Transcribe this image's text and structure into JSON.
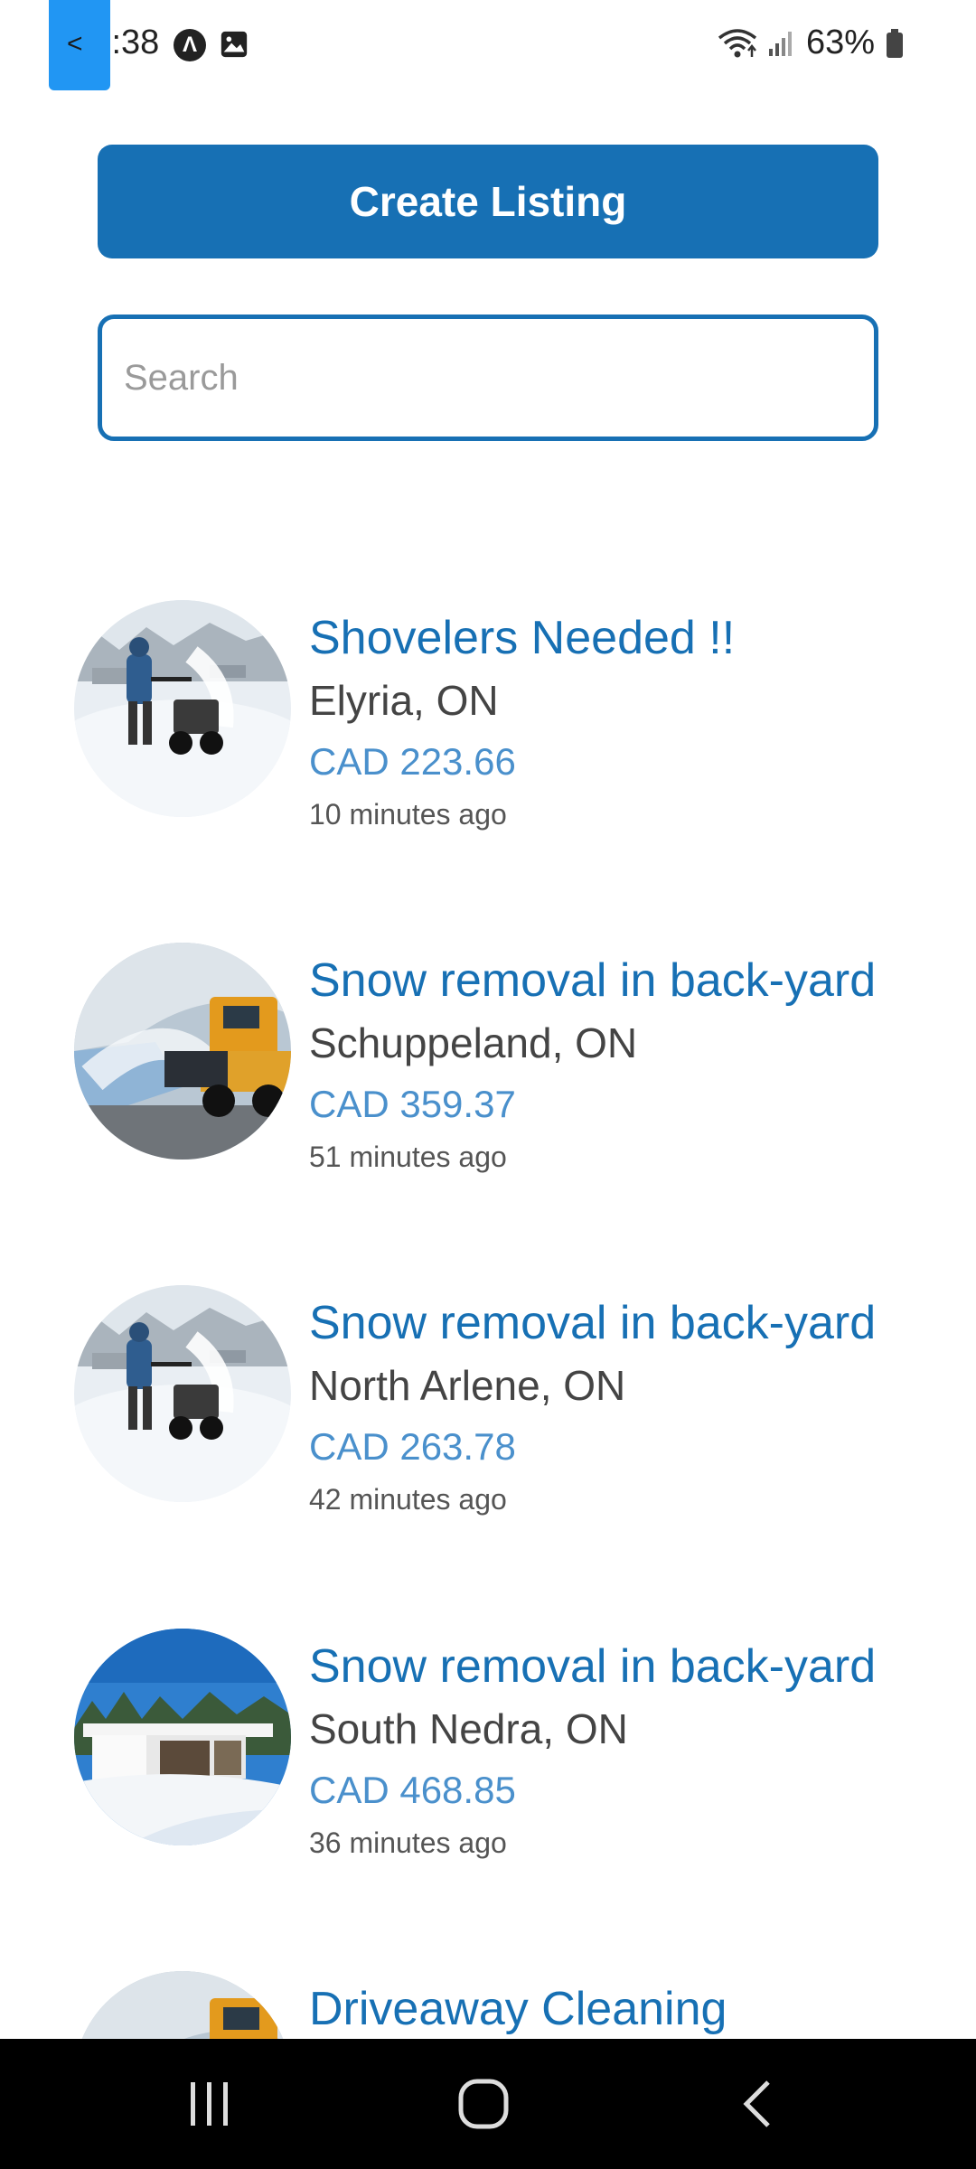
{
  "status_bar": {
    "time": "11:38",
    "battery": "63%",
    "icons": [
      "a-badge-icon",
      "image-icon",
      "wifi-icon",
      "signal-icon",
      "battery-icon"
    ]
  },
  "actions": {
    "create_label": "Create Listing"
  },
  "search": {
    "placeholder": "Search",
    "value": ""
  },
  "listings": [
    {
      "title": "Shovelers Needed !!",
      "location": "Elyria, ON",
      "price": "CAD 223.66",
      "time": "10 minutes ago",
      "image": "snowblower"
    },
    {
      "title": "Snow removal in back-yard",
      "location": "Schuppeland, ON",
      "price": "CAD 359.37",
      "time": "51 minutes ago",
      "image": "snowplow"
    },
    {
      "title": "Snow removal in back-yard",
      "location": "North Arlene, ON",
      "price": "CAD 263.78",
      "time": "42 minutes ago",
      "image": "snowblower"
    },
    {
      "title": "Snow removal in back-yard",
      "location": "South Nedra, ON",
      "price": "CAD 468.85",
      "time": "36 minutes ago",
      "image": "house"
    },
    {
      "title": "Driveaway Cleaning",
      "location": "",
      "price": "",
      "time": "",
      "image": "snowplow"
    }
  ],
  "colors": {
    "primary": "#1770b4",
    "price": "#4a90cc",
    "nav_bg": "#000000"
  }
}
